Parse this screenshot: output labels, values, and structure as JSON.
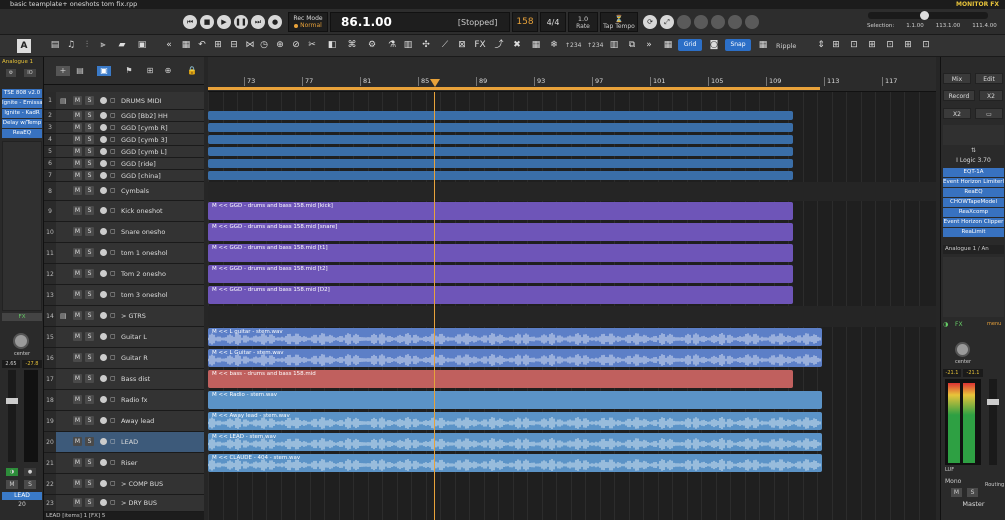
{
  "title": "basic teamplate+ oneshots tom fix.rpp",
  "monitor_fx": "MONITOR FX",
  "transport": {
    "rec_mode_label": "Rec Mode",
    "rec_mode_value": "Normal",
    "position": "86.1.00",
    "status": "[Stopped]",
    "bpm": "158",
    "time_sig": "4/4",
    "rate_value": "1.0",
    "rate_label": "Rate",
    "tap_tempo": "Tap Tempo",
    "selection_label": "Selection:",
    "selection": [
      "1.1.00",
      "113.1.00",
      "111.4.00"
    ]
  },
  "toolbar": {
    "grid": "Grid",
    "snap": "Snap",
    "ripple": "Ripple",
    "t34a": "↑234",
    "t34b": "↑234"
  },
  "left_panel": {
    "track_name": "Analogue 1",
    "io": "IO",
    "fx": [
      "TSE 808 v2.0",
      "Ignite - Emissa",
      "Ignite - KadR",
      "Delay w/Temp",
      "ReaEQ"
    ],
    "pan": "center",
    "vol_left": "2.65",
    "vol_right": "-27.8",
    "sel_track": "LEAD",
    "sel_num": "20"
  },
  "ruler": {
    "marks": [
      "73",
      "77",
      "81",
      "85",
      "89",
      "93",
      "97",
      "101",
      "105",
      "109",
      "113",
      "117"
    ]
  },
  "tracks": [
    {
      "n": "1",
      "name": "DRUMS MIDI",
      "folder": true
    },
    {
      "n": "2",
      "name": "GGD [Bb2] HH"
    },
    {
      "n": "3",
      "name": "GGD [cymb R]"
    },
    {
      "n": "4",
      "name": "GGD [cymb 3]"
    },
    {
      "n": "5",
      "name": "GGD [cymb L]"
    },
    {
      "n": "6",
      "name": "GGD [ride]"
    },
    {
      "n": "7",
      "name": "GGD [china]"
    },
    {
      "n": "8",
      "name": "Cymbals"
    },
    {
      "n": "9",
      "name": "Kick oneshot"
    },
    {
      "n": "10",
      "name": "Snare onesho"
    },
    {
      "n": "11",
      "name": "tom 1 oneshol"
    },
    {
      "n": "12",
      "name": "Tom 2 onesho"
    },
    {
      "n": "13",
      "name": "tom 3 oneshol"
    },
    {
      "n": "14",
      "name": "> GTRS",
      "folder": true
    },
    {
      "n": "15",
      "name": "Guitar L"
    },
    {
      "n": "16",
      "name": "Guitar R"
    },
    {
      "n": "17",
      "name": "Bass dist"
    },
    {
      "n": "18",
      "name": "Radio  fx"
    },
    {
      "n": "19",
      "name": "Away lead"
    },
    {
      "n": "20",
      "name": "LEAD",
      "selected": true
    },
    {
      "n": "21",
      "name": "Riser"
    },
    {
      "n": "22",
      "name": "> COMP BUS"
    },
    {
      "n": "23",
      "name": "> DRY BUS"
    }
  ],
  "items": {
    "kick": "M << GGD - drums and bass 158.mid [kick]",
    "snare": "M << GGD - drums and bass 158.mid [snare]",
    "t1": "M << GGD - drums and bass 158.mid [t1]",
    "t2": "M << GGD - drums and bass 158.mid [t2]",
    "d2": "M << GGD - drums and bass 158.mid [D2]",
    "gtrL": "M << L guitar - stem.wav",
    "gtrR": "M << L Guitar - stem.wav",
    "bass": "M << bass - drums and bass 158.mid",
    "radio": "M << Radio - stem.wav",
    "away": "M << Away lead - stem.wav",
    "lead": "M << LEAD - stem.wav",
    "riser": "M << CLAUDE - 404 - stem.wav"
  },
  "right_panel": {
    "mix": "Mix",
    "edit": "Edit",
    "record": "Record",
    "x2": "X2",
    "x2b": "X2",
    "logic": "I Logic 3.70",
    "fx": [
      "EQT-1A",
      "Event Horizon Limiterll",
      "ReaEQ",
      "CHOWTapeModel",
      "ReaXcomp",
      "Event Horizon Clipper",
      "ReaLimit"
    ],
    "track_name": "Analogue 1 / An",
    "fx_label": "FX",
    "pan": "center",
    "vol_left": "-21.1",
    "vol_right": "-21.1",
    "lufs": "LUF",
    "mono": "Mono",
    "master": "Master",
    "routing": "Routing",
    "menu": "menu"
  },
  "status": "LEAD [items] 1 [FX] 5"
}
